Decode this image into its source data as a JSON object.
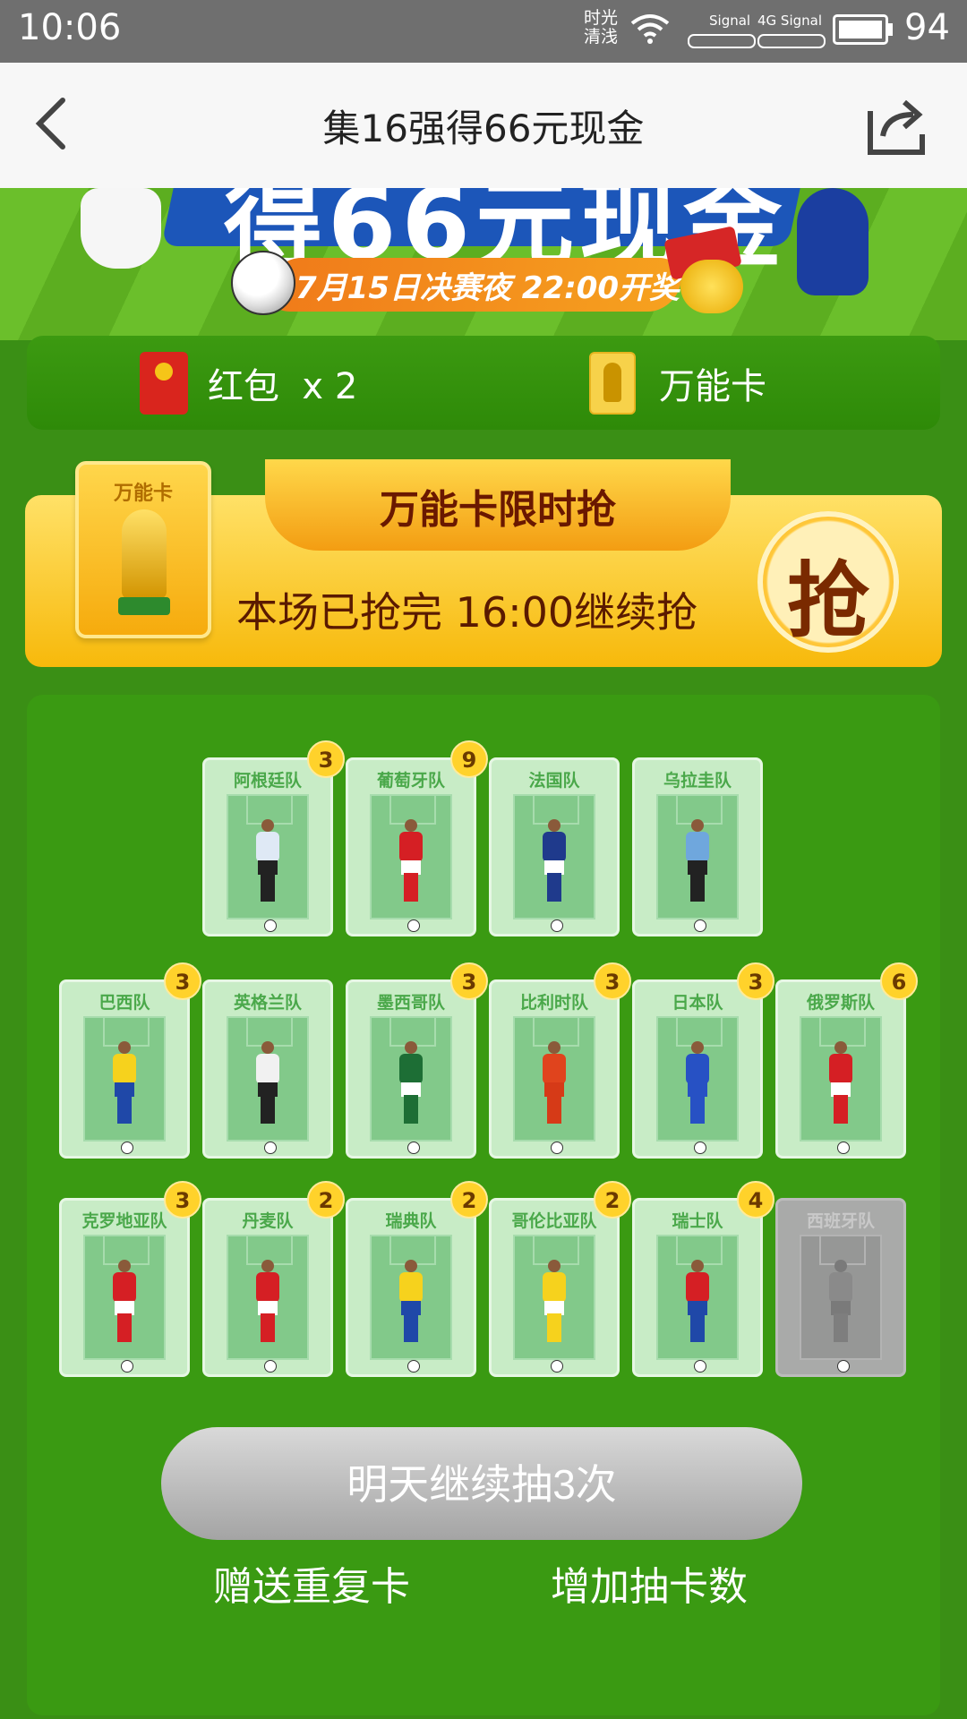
{
  "status_bar": {
    "time": "10:06",
    "carrier_line1": "时光",
    "carrier_line2": "清浅",
    "signal1_label": "Signal",
    "signal2_label": "4G Signal",
    "battery": "94"
  },
  "nav": {
    "title": "集16强得66元现金",
    "back_icon": "chevron-left-icon",
    "share_icon": "share-icon"
  },
  "banner": {
    "headline_fragment": "得66元现金",
    "draw_date": "7月15日决赛夜 22:00开奖"
  },
  "resources": {
    "red_packet": "红包  x 2",
    "wild_card": "万能卡"
  },
  "flash_sale": {
    "title": "万能卡限时抢",
    "status": "本场已抢完 16:00继续抢",
    "grab_label": "抢",
    "card_label": "万能卡"
  },
  "teams": [
    {
      "name": "阿根廷队",
      "count": "3",
      "shirt": "#dfe9f5",
      "shorts": "#222222"
    },
    {
      "name": "葡萄牙队",
      "count": "9",
      "shirt": "#d51f24",
      "shorts": "#ffffff"
    },
    {
      "name": "法国队",
      "count": "",
      "shirt": "#1f3a8c",
      "shorts": "#ffffff"
    },
    {
      "name": "乌拉圭队",
      "count": "",
      "shirt": "#6fa7dd",
      "shorts": "#222222"
    },
    {
      "name": "巴西队",
      "count": "3",
      "shirt": "#f6d21d",
      "shorts": "#1f48a8"
    },
    {
      "name": "英格兰队",
      "count": "",
      "shirt": "#f1f1f1",
      "shorts": "#222222"
    },
    {
      "name": "墨西哥队",
      "count": "3",
      "shirt": "#1d6e35",
      "shorts": "#ffffff"
    },
    {
      "name": "比利时队",
      "count": "3",
      "shirt": "#e0441d",
      "shorts": "#d63a17"
    },
    {
      "name": "日本队",
      "count": "3",
      "shirt": "#2751c4",
      "shorts": "#2751c4"
    },
    {
      "name": "俄罗斯队",
      "count": "6",
      "shirt": "#d51f24",
      "shorts": "#ffffff"
    },
    {
      "name": "克罗地亚队",
      "count": "3",
      "shirt": "#d51f24",
      "shorts": "#ffffff"
    },
    {
      "name": "丹麦队",
      "count": "2",
      "shirt": "#d51f24",
      "shorts": "#ffffff"
    },
    {
      "name": "瑞典队",
      "count": "2",
      "shirt": "#f6d21d",
      "shorts": "#1f48a8"
    },
    {
      "name": "哥伦比亚队",
      "count": "2",
      "shirt": "#f6d21d",
      "shorts": "#ffffff"
    },
    {
      "name": "瑞士队",
      "count": "4",
      "shirt": "#d51f24",
      "shorts": "#1f48a8"
    },
    {
      "name": "西班牙队",
      "count": "",
      "shirt": "#8a8a8a",
      "shorts": "#7a7a7a",
      "collected": false
    }
  ],
  "draw_button": "明天继续抽3次",
  "footer": {
    "gift": "赠送重复卡",
    "add_draws": "增加抽卡数"
  }
}
